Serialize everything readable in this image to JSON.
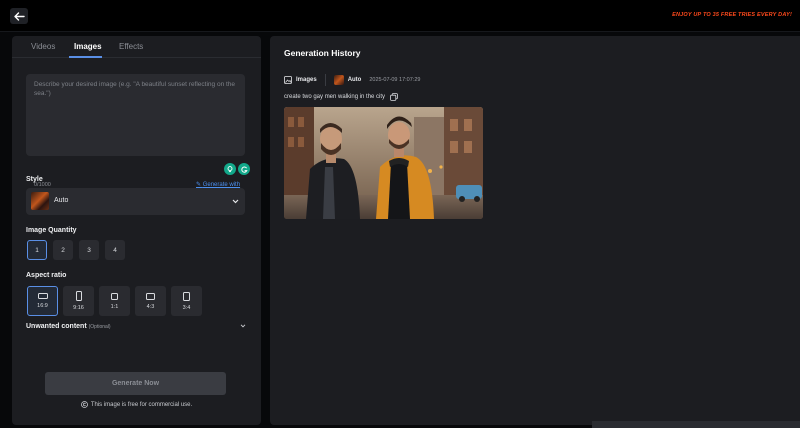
{
  "header": {
    "promo_text": "ENJOY UP TO 35 FREE TRIES EVERY DAY!",
    "back_icon": "arrow-left-icon"
  },
  "tabs": [
    {
      "label": "Videos"
    },
    {
      "label": "Images",
      "active": true
    },
    {
      "label": "Effects"
    }
  ],
  "prompt": {
    "placeholder": "Describe your desired image (e.g. \"A beautiful sunset reflecting on the sea.\")",
    "value": "",
    "char_count": "0/1000",
    "generate_ai_label": "Generate with AI"
  },
  "style": {
    "label": "Style",
    "selected": "Auto"
  },
  "quantity": {
    "label": "Image Quantity",
    "options": [
      "1",
      "2",
      "3",
      "4"
    ],
    "selected": "1"
  },
  "aspect": {
    "label": "Aspect ratio",
    "options": [
      "16:9",
      "9:16",
      "1:1",
      "4:3",
      "3:4"
    ],
    "selected": "16:9"
  },
  "unwanted": {
    "label": "Unwanted content",
    "optional": "(Optional)"
  },
  "generate_button": "Generate Now",
  "free_note": "This image is free for commercial use.",
  "history": {
    "title": "Generation History",
    "type": "Images",
    "style": "Auto",
    "timestamp": "2025-07-09 17:07:29",
    "prompt": "create two gay men walking in the city"
  },
  "colors": {
    "accent": "#5a8fe6",
    "promo": "#ff4a1c",
    "ai_badge": "#12a88a",
    "link": "#4c90f0"
  }
}
